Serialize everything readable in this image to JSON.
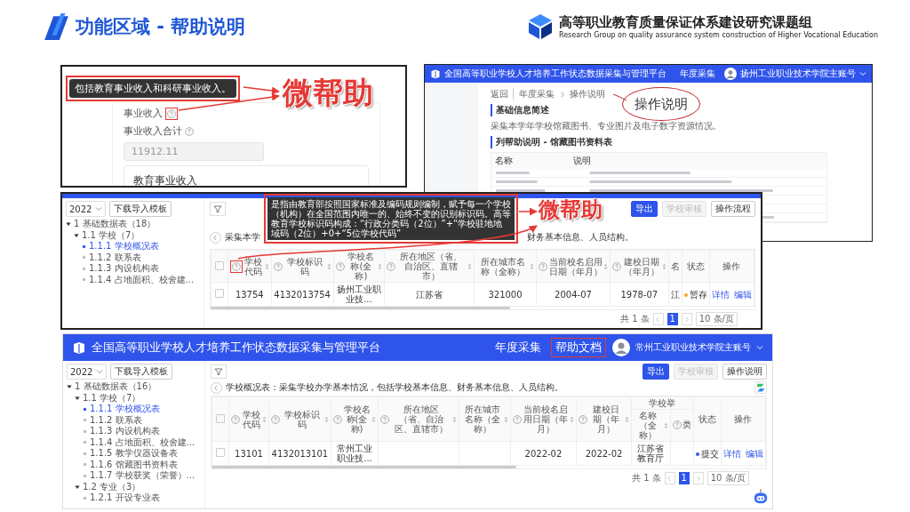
{
  "slide": {
    "title": "功能区域 - 帮助说明",
    "org_name": "高等职业教育质量保证体系建设研究课题组",
    "org_subtitle": "Research Group on quality assurance system construction of Higher Vocational Education"
  },
  "income_panel": {
    "tooltip": "包括教育事业收入和科研事业收入。",
    "field_label": "事业收入",
    "field_help_highlighted": true,
    "total_label": "事业收入合计",
    "total_value": "11912.11",
    "card_label": "教育事业收入",
    "callout": "微帮助"
  },
  "manual_panel": {
    "app_title": "全国高等职业学校人才培养工作状态数据采集与管理平台",
    "nav": [
      {
        "label": "年度采集",
        "highlighted": false
      }
    ],
    "account": "扬州工业职业技术学院主账号",
    "breadcrumb": [
      "返回",
      "年度采集",
      "操作说明"
    ],
    "section_1": "基础信息简述",
    "description": "采集本学年学校馆藏图书、专业图片及电子数字资源情况。",
    "section_2": "列帮助说明 - 馆藏图书资料表",
    "table_columns": [
      "名称",
      "说明"
    ],
    "callout": "操作说明"
  },
  "fields_panel": {
    "sidebar": {
      "year": "2022",
      "template_button": "下载导入模板",
      "tree": [
        {
          "label": "1 基础数据表（18）",
          "selected": false,
          "expanded": true,
          "children": [
            {
              "label": "1.1 学校（7）",
              "selected": false,
              "expanded": true,
              "children": [
                {
                  "label": "1.1.1 学校概况表",
                  "selected": true
                },
                {
                  "label": "1.1.2 联系表",
                  "selected": false
                },
                {
                  "label": "1.1.3 内设机构表",
                  "selected": false
                },
                {
                  "label": "1.1.4 占地面积、校舍建...",
                  "selected": false
                }
              ]
            }
          ]
        }
      ]
    },
    "buttons": [
      {
        "label": "导出",
        "kind": "primary",
        "disabled": false
      },
      {
        "label": "学校审核",
        "kind": "default",
        "disabled": true
      },
      {
        "label": "操作流程",
        "kind": "default",
        "disabled": false
      }
    ],
    "description_start": "采集本学",
    "description_end": "财务基本信息、人员结构。",
    "tooltip": "是指由教育部按照国家标准及编码规则编制，赋予每一个学校（机构）在全国范围内唯一的、始终不变的识别标识码。高等教育学校标识码构成：“行政分类码（2位）”+“学校驻地地域码（2位）+0+“5位学校代码”",
    "table": {
      "select_all": {
        "checked": false
      },
      "status_header": "状态",
      "actions_header": "操作",
      "columns": [
        {
          "label": "学校代码",
          "help": true,
          "sortable": true,
          "highlighted": true
        },
        {
          "label": "学校标识码",
          "help": true,
          "sortable": true,
          "highlighted": false
        },
        {
          "label": "学校名称(全称)",
          "help": true,
          "sortable": true,
          "highlighted": false
        },
        {
          "label": "所在地区（省、自治区、直辖市）",
          "help": true,
          "sortable": true,
          "highlighted": false
        },
        {
          "label": "所在城市名称（全称）",
          "help": false,
          "sortable": true,
          "highlighted": false
        },
        {
          "label": "当前校名启用日期（年月）",
          "help": true,
          "sortable": true,
          "highlighted": false
        },
        {
          "label": "建校日期（年月）",
          "help": true,
          "sortable": true,
          "highlighted": false
        },
        {
          "label": "名",
          "help": false,
          "sortable": false,
          "highlighted": false
        }
      ],
      "rows": [
        {
          "checked": false,
          "cells": [
            "13754",
            "4132013754",
            "扬州工业职业技...",
            "江苏省",
            "321000",
            "2004-07",
            "1978-07",
            "江"
          ],
          "status": {
            "label": "暂存",
            "color": "#f5a623"
          },
          "actions": [
            "详情",
            "编辑"
          ]
        }
      ]
    },
    "pagination": {
      "total": "共 1 条",
      "pages": [
        {
          "label": "1",
          "selected": true
        }
      ],
      "page_size": "10 条/页"
    },
    "callout": "微帮助"
  },
  "platform_panel": {
    "app_title": "全国高等职业学校人才培养工作状态数据采集与管理平台",
    "nav": [
      {
        "label": "年度采集",
        "highlighted": false
      },
      {
        "label": "帮助文档",
        "highlighted": true
      }
    ],
    "account": "常州工业职业技术学院主账号",
    "sidebar": {
      "year": "2022",
      "template_button": "下载导入模板",
      "tree": [
        {
          "label": "1 基础数据表（16）",
          "selected": false,
          "expanded": true,
          "children": [
            {
              "label": "1.1 学校（7）",
              "selected": false,
              "expanded": true,
              "children": [
                {
                  "label": "1.1.1 学校概况表",
                  "selected": true
                },
                {
                  "label": "1.1.2 联系表",
                  "selected": false
                },
                {
                  "label": "1.1.3 内设机构表",
                  "selected": false
                },
                {
                  "label": "1.1.4 占地面积、校舍建...",
                  "selected": false
                },
                {
                  "label": "1.1.5 教学仪器设备表",
                  "selected": false
                },
                {
                  "label": "1.1.6 馆藏图书资料表",
                  "selected": false
                },
                {
                  "label": "1.1.7 学校获奖（荣誉）...",
                  "selected": false
                }
              ]
            },
            {
              "label": "1.2 专业（3）",
              "selected": false,
              "expanded": true,
              "children": [
                {
                  "label": "1.2.1 开设专业表",
                  "selected": false
                }
              ]
            }
          ]
        }
      ]
    },
    "buttons": [
      {
        "label": "导出",
        "kind": "primary",
        "disabled": false
      },
      {
        "label": "学校审核",
        "kind": "default",
        "disabled": true
      },
      {
        "label": "操作说明",
        "kind": "default",
        "disabled": false
      }
    ],
    "description": "学校概况表：采集学校办学基本情况，包括学校基本信息、财务基本信息、人员结构。",
    "table": {
      "select_all": {
        "checked": false
      },
      "status_header": "状态",
      "actions_header": "操作",
      "columns": [
        {
          "label": "学校代码",
          "help": true,
          "sortable": true
        },
        {
          "label": "学校标识码",
          "help": true,
          "sortable": true
        },
        {
          "label": "学校名称(全称)",
          "help": true,
          "sortable": true
        },
        {
          "label": "所在地区（省、自治区、直辖市）",
          "help": true,
          "sortable": true
        },
        {
          "label": "所在城市名称（全称）",
          "help": false,
          "sortable": true
        },
        {
          "label": "当前校名启用日期（年月）",
          "help": true,
          "sortable": true
        },
        {
          "label": "建校日期（年月）",
          "help": true,
          "sortable": true
        },
        {
          "group": "学校举",
          "children": [
            {
              "label": "名称（全称）",
              "help": false,
              "sortable": true
            },
            {
              "label": "类",
              "help": true,
              "sortable": false
            }
          ]
        }
      ],
      "rows": [
        {
          "checked": false,
          "cells": [
            "13101",
            "4132013101",
            "常州工业职业技...",
            null,
            null,
            "2022-02",
            "2022-02",
            "江苏省教育厅",
            null
          ],
          "status": {
            "label": "提交",
            "color": "#2f54eb"
          },
          "actions": [
            "详情",
            "编辑"
          ]
        }
      ]
    },
    "pagination": {
      "total": "共 1 条",
      "pages": [
        {
          "label": "1",
          "selected": true
        }
      ],
      "page_size": "10 条/页"
    }
  }
}
